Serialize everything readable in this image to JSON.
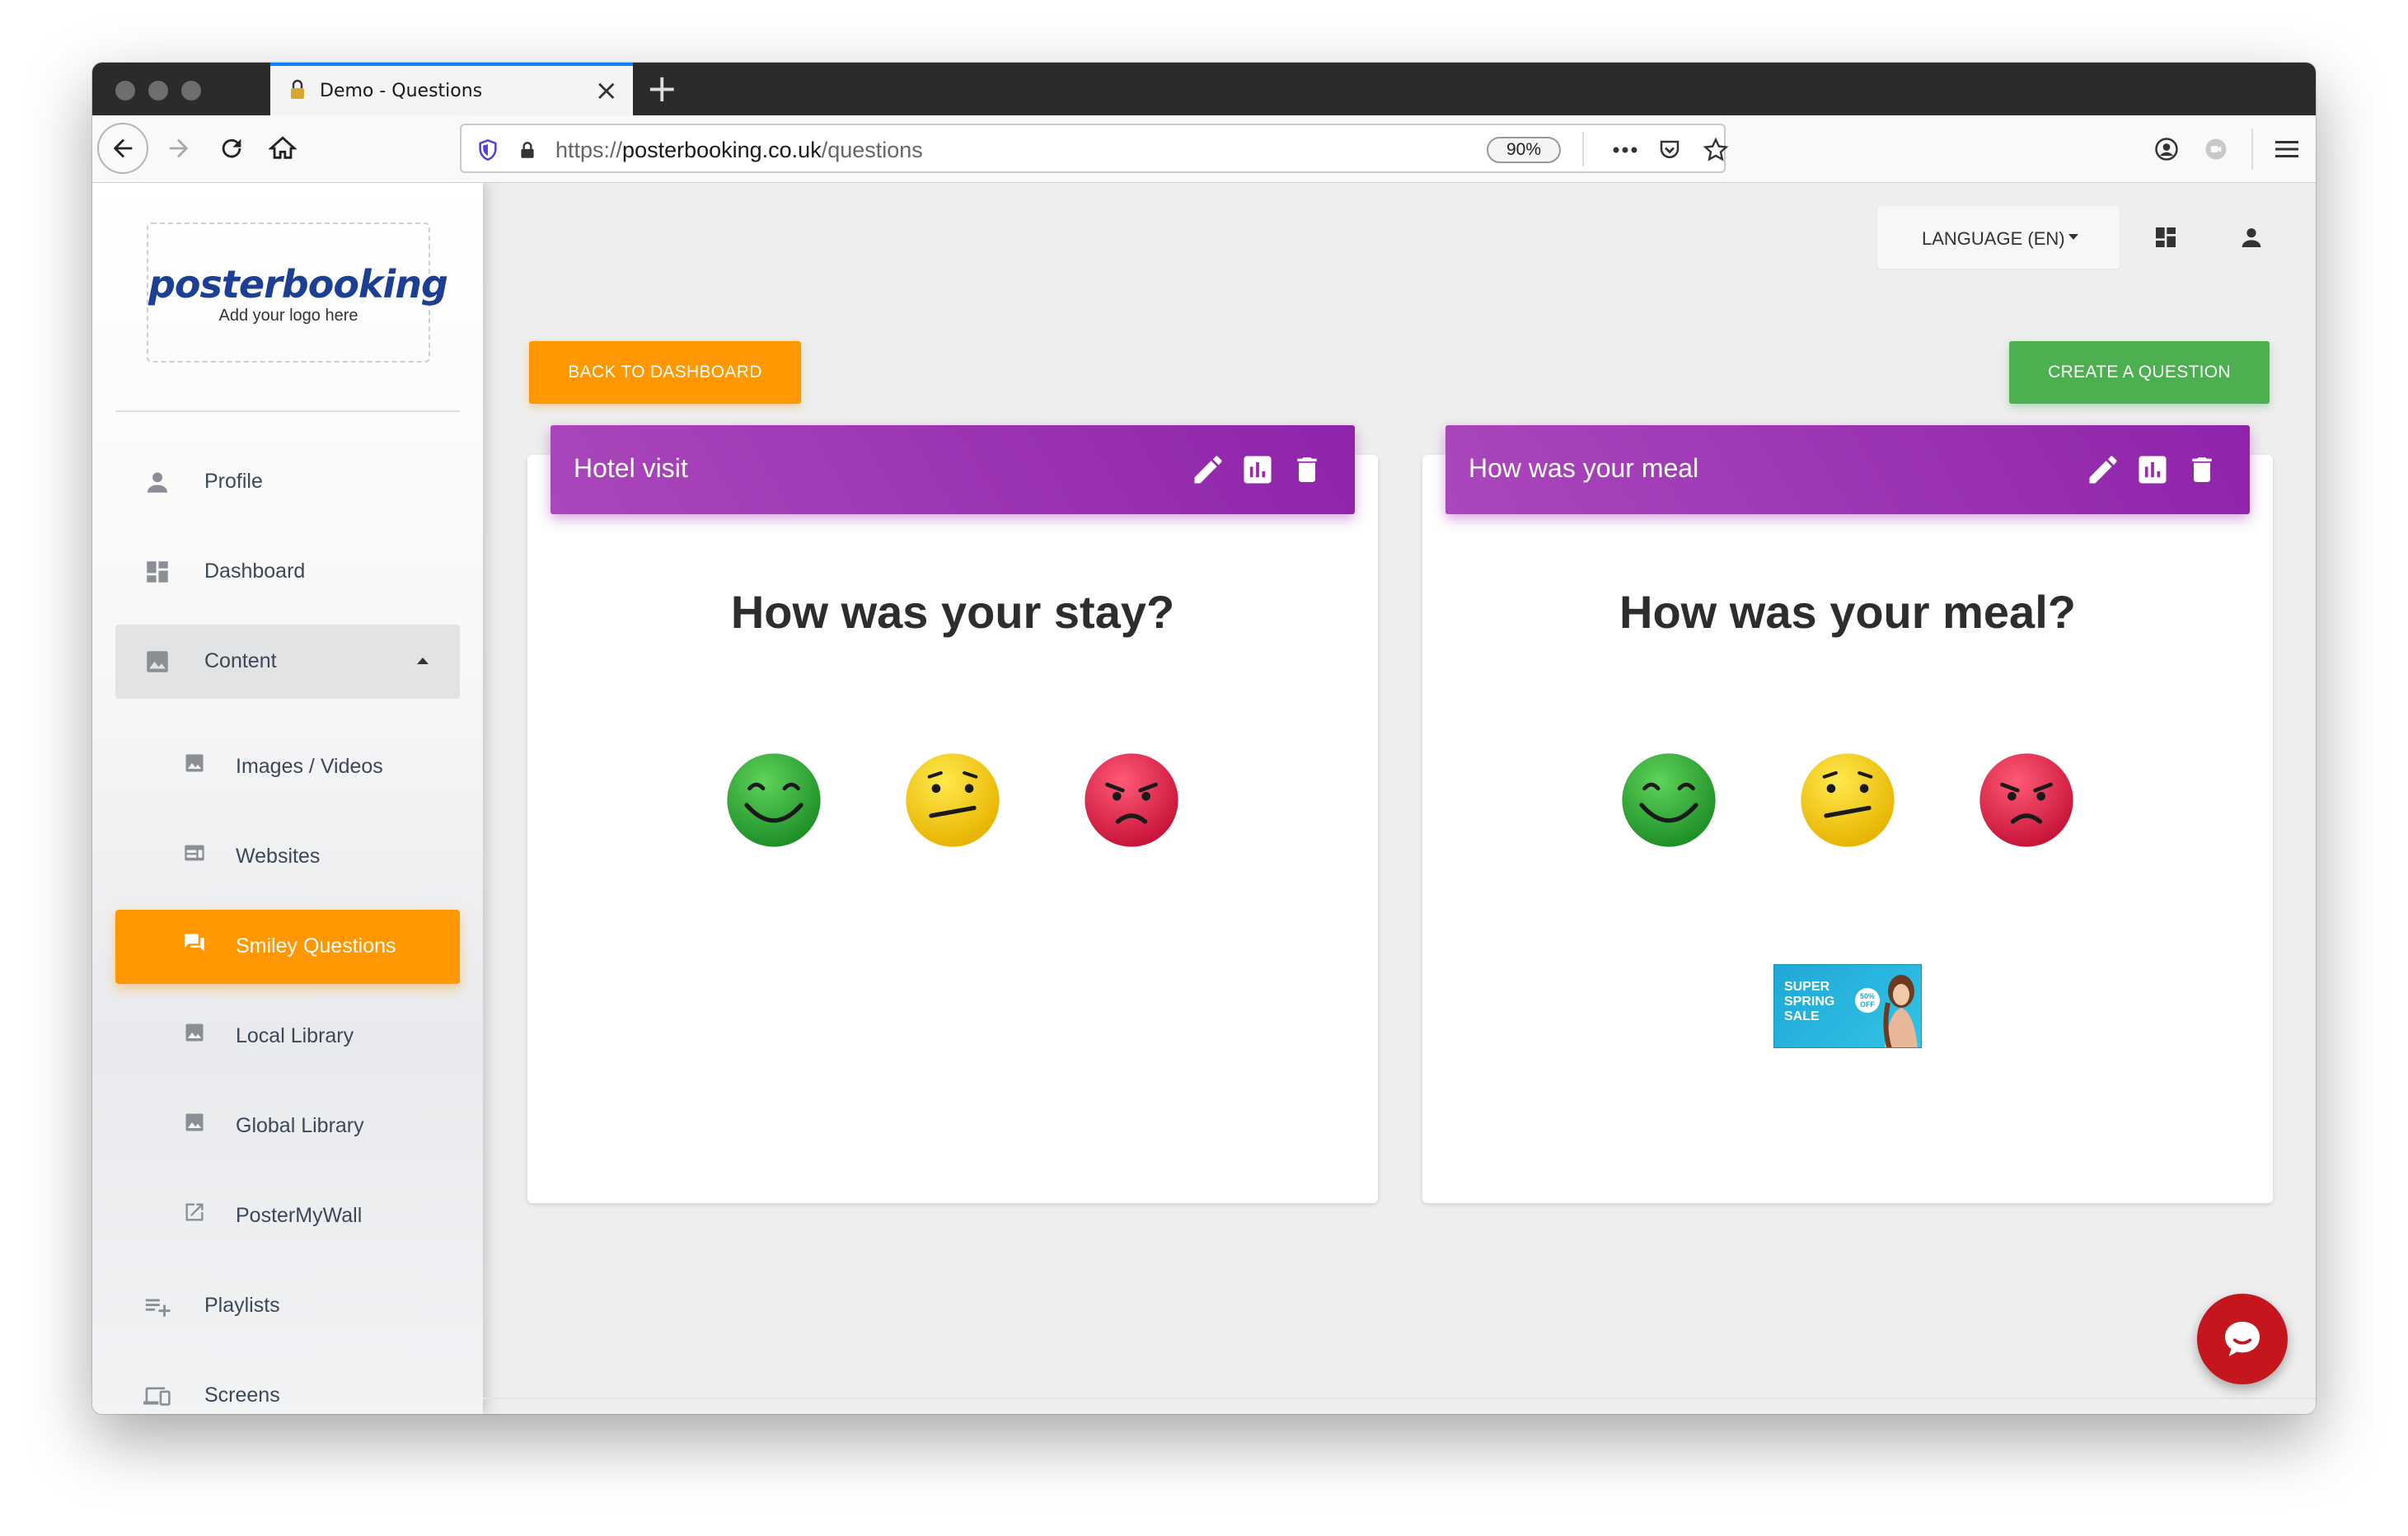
{
  "browser": {
    "tab_title": "Demo - Questions",
    "url_scheme": "https://",
    "url_host": "posterbooking.co.uk",
    "url_path": "/questions",
    "zoom": "90%"
  },
  "sidebar": {
    "logo_text": "posterbooking",
    "logo_subtext": "Add your logo here",
    "items": [
      {
        "label": "Profile",
        "icon": "person-icon"
      },
      {
        "label": "Dashboard",
        "icon": "dashboard-icon"
      },
      {
        "label": "Content",
        "icon": "image-icon",
        "expanded": true
      },
      {
        "label": "Images / Videos",
        "icon": "image-icon"
      },
      {
        "label": "Websites",
        "icon": "web-icon"
      },
      {
        "label": "Smiley Questions",
        "icon": "chat-icon",
        "active": true
      },
      {
        "label": "Local Library",
        "icon": "image-icon"
      },
      {
        "label": "Global Library",
        "icon": "image-icon"
      },
      {
        "label": "PosterMyWall",
        "icon": "external-link-icon"
      },
      {
        "label": "Playlists",
        "icon": "playlist-add-icon"
      },
      {
        "label": "Screens",
        "icon": "devices-icon"
      }
    ]
  },
  "header": {
    "language_label": "LANGUAGE (EN)"
  },
  "actions": {
    "back_label": "BACK TO DASHBOARD",
    "create_label": "CREATE A QUESTION"
  },
  "cards": [
    {
      "title": "Hotel visit",
      "question": "How was your stay?"
    },
    {
      "title": "How was your meal",
      "question": "How was your meal?",
      "promo": {
        "line1": "SUPER",
        "line2": "SPRING",
        "line3": "SALE",
        "badge_line1": "50%",
        "badge_line2": "OFF"
      }
    }
  ],
  "colors": {
    "accent_orange": "#ff9800",
    "accent_green": "#4caf50",
    "card_header_purple": "#9c27b0",
    "chat_red": "#c4161c"
  }
}
